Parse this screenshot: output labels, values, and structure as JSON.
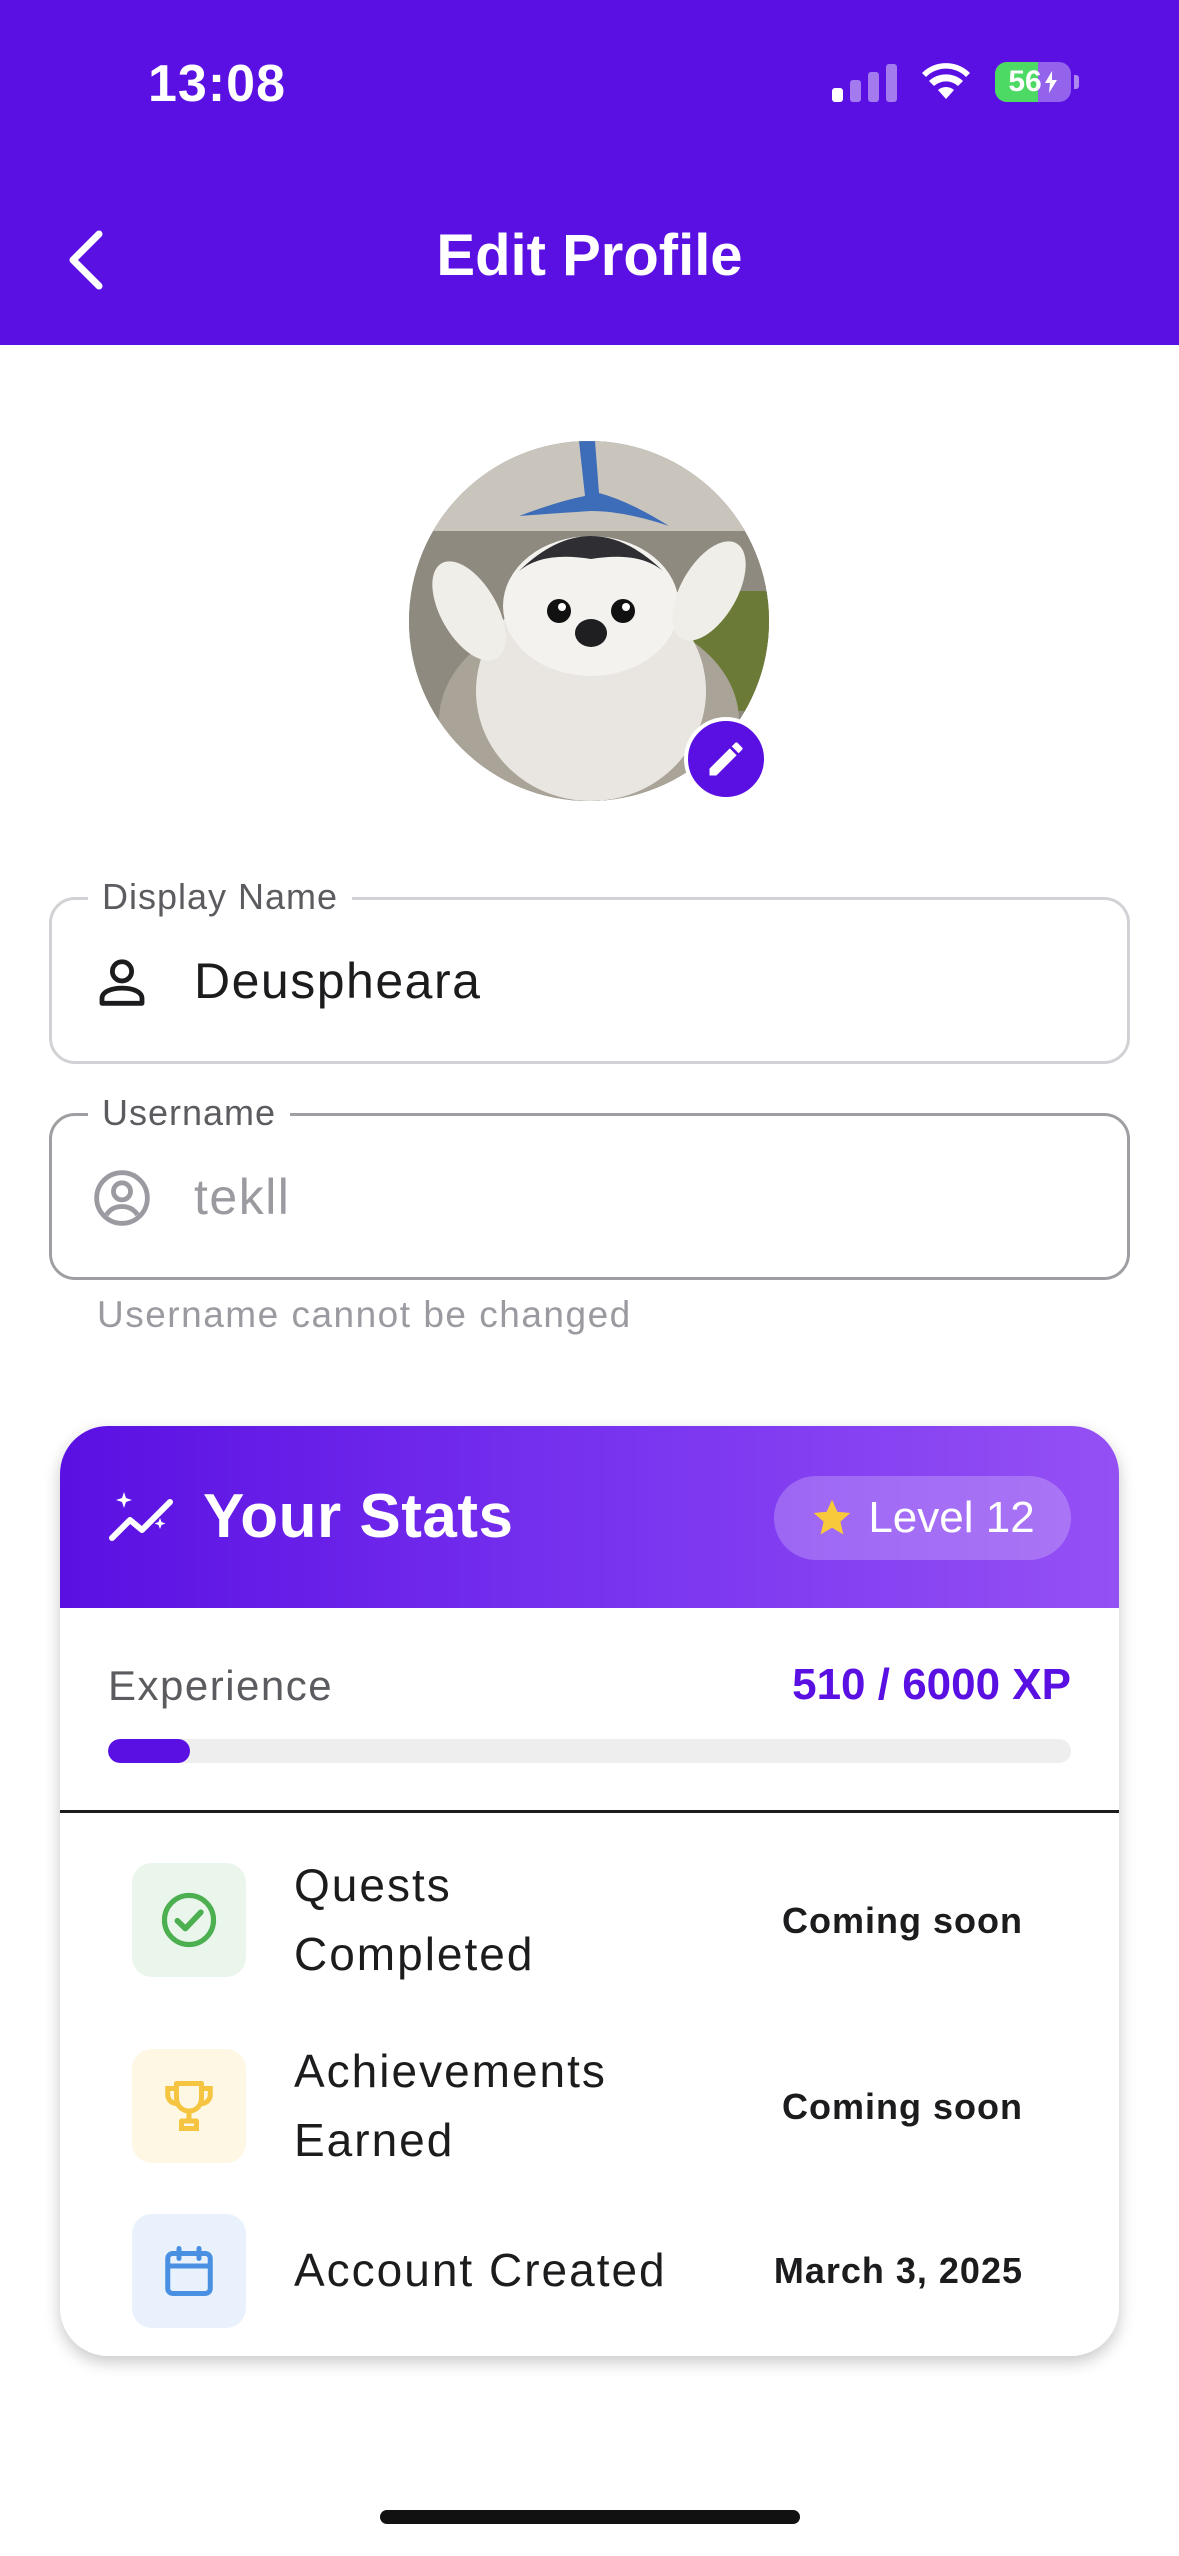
{
  "status_bar": {
    "time": "13:08",
    "battery": "56",
    "icons": [
      "cellular-signal-icon",
      "wifi-icon",
      "battery-charging-icon"
    ]
  },
  "header": {
    "title": "Edit Profile",
    "back_icon": "chevron-left-icon",
    "background": "#5a10e2"
  },
  "avatar": {
    "edit_icon": "pencil-icon"
  },
  "display_name": {
    "label": "Display Name",
    "value": "Deuspheara",
    "icon": "person-icon"
  },
  "username": {
    "label": "Username",
    "value": "tekll",
    "icon": "account-circle-icon",
    "helper": "Username cannot be changed"
  },
  "stats": {
    "title": "Your Stats",
    "title_icon": "trending-sparkle-icon",
    "level": "Level 12",
    "level_icon": "star-icon",
    "experience_label": "Experience",
    "experience_value": "510 / 6000 XP",
    "experience_fraction": 0.085,
    "rows": [
      {
        "label": "Quests Completed",
        "value": "Coming soon",
        "icon": "check-circle-icon",
        "icon_color": "#4caf50",
        "icon_bg": "#eaf6ec"
      },
      {
        "label": "Achievements Earned",
        "value": "Coming soon",
        "icon": "trophy-icon",
        "icon_color": "#f5c542",
        "icon_bg": "#fdf7e3"
      },
      {
        "label": "Account Created",
        "value": "March 3, 2025",
        "icon": "calendar-icon",
        "icon_color": "#4a90e2",
        "icon_bg": "#e8f1fc"
      }
    ]
  },
  "colors": {
    "accent": "#5a10e2",
    "gradient_end": "#9550f4"
  }
}
